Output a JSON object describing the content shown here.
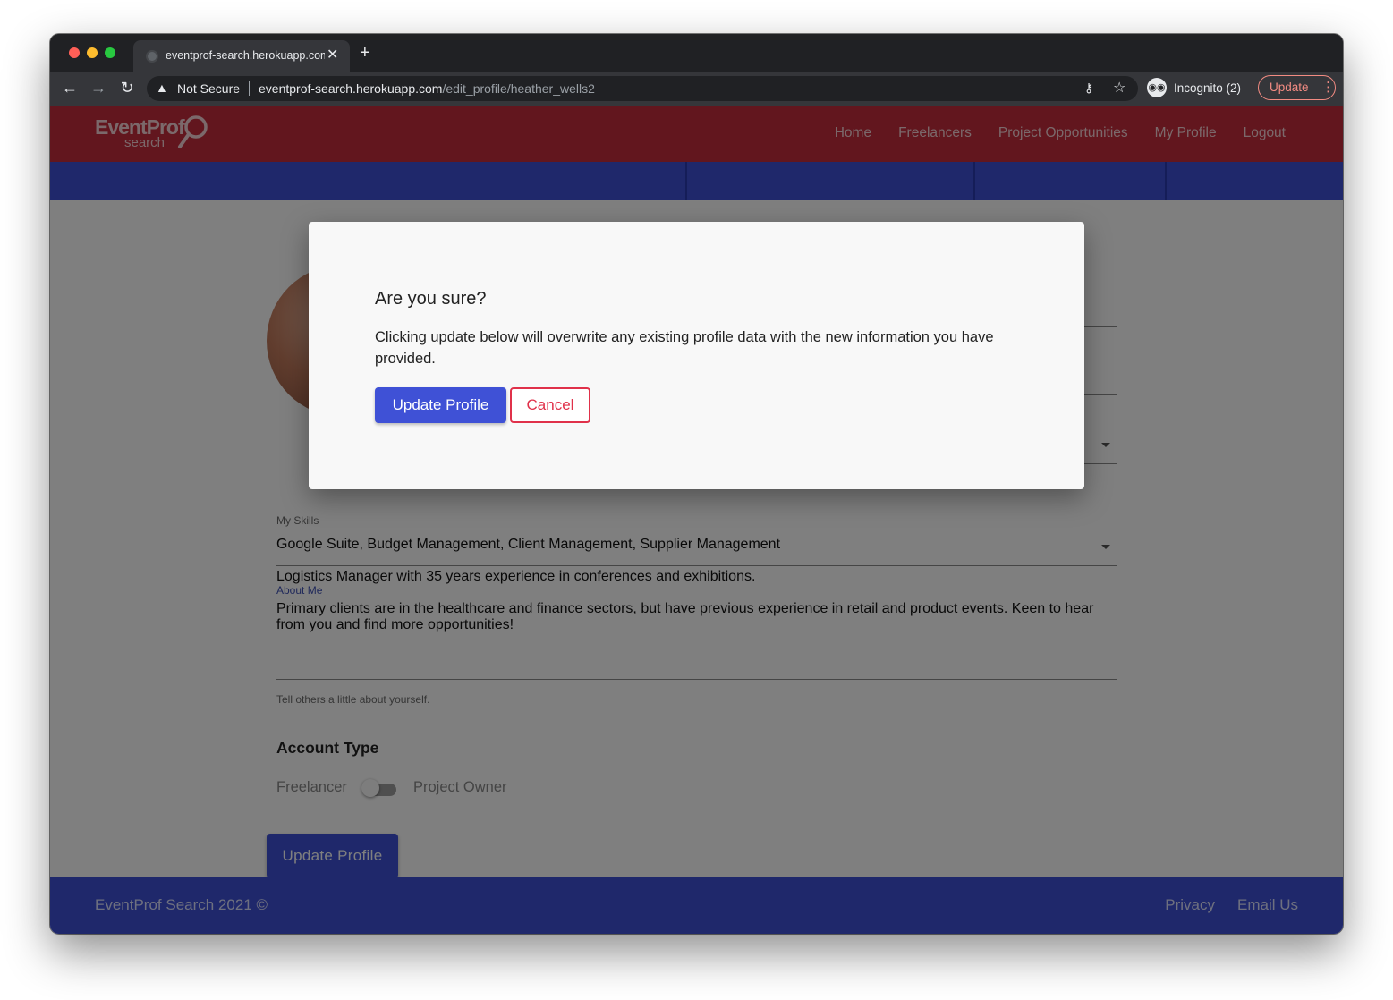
{
  "browser": {
    "tab_title": "eventprof-search.herokuapp.com",
    "new_tab_glyph": "+",
    "close_glyph": "✕",
    "security_label": "Not Secure",
    "url_host": "eventprof-search.herokuapp.com",
    "url_path": "/edit_profile/heather_wells2",
    "incognito_label": "Incognito (2)",
    "update_label": "Update"
  },
  "site": {
    "logo_line1": "EventProf",
    "logo_line2": "search",
    "nav": [
      "Home",
      "Freelancers",
      "Project Opportunities",
      "My Profile",
      "Logout"
    ],
    "colors": {
      "header": "#c52c3d",
      "primary": "#3f51d6",
      "cancel": "#e0314a"
    }
  },
  "form": {
    "skills_label": "My Skills",
    "skills_value": "Google Suite, Budget Management, Client Management, Supplier Management",
    "about_label": "About Me",
    "about_paragraphs": [
      "Logistics Manager with 35 years experience in conferences and exhibitions.",
      "Primary clients are in the healthcare and finance sectors, but have previous experience in retail and product events. Keen to hear from you and find more opportunities!"
    ],
    "about_hint": "Tell others a little about yourself.",
    "account_type_heading": "Account Type",
    "toggle_left": "Freelancer",
    "toggle_right": "Project Owner",
    "submit_label": "Update Profile"
  },
  "footer": {
    "copyright": "EventProf Search 2021 ©",
    "links": [
      "Privacy",
      "Email Us"
    ]
  },
  "modal": {
    "title": "Are you sure?",
    "body": "Clicking update below will overwrite any existing profile data with the new information you have provided.",
    "confirm_label": "Update Profile",
    "cancel_label": "Cancel"
  }
}
